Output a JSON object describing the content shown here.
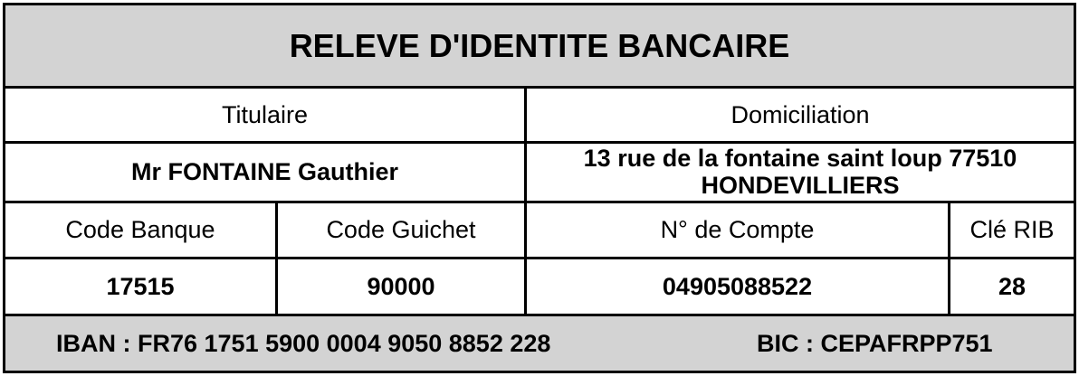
{
  "document": {
    "title": "RELEVE D'IDENTITE BANCAIRE",
    "headers": {
      "titulaire": "Titulaire",
      "domiciliation": "Domiciliation",
      "code_banque": "Code Banque",
      "code_guichet": "Code Guichet",
      "numero_compte": "N° de Compte",
      "cle_rib": "Clé RIB"
    },
    "values": {
      "titulaire": "Mr FONTAINE Gauthier",
      "domiciliation_line1": "13 rue de la fontaine saint loup 77510",
      "domiciliation_line2": "HONDEVILLIERS",
      "code_banque": "17515",
      "code_guichet": "90000",
      "numero_compte": "04905088522",
      "cle_rib": "28"
    },
    "iban": "IBAN : FR76 1751 5900 0004 9050 8852 228",
    "bic": "BIC : CEPAFRPP751"
  },
  "colors": {
    "header_background": "#d3d3d3",
    "border": "#000000",
    "cell_background": "#ffffff"
  }
}
